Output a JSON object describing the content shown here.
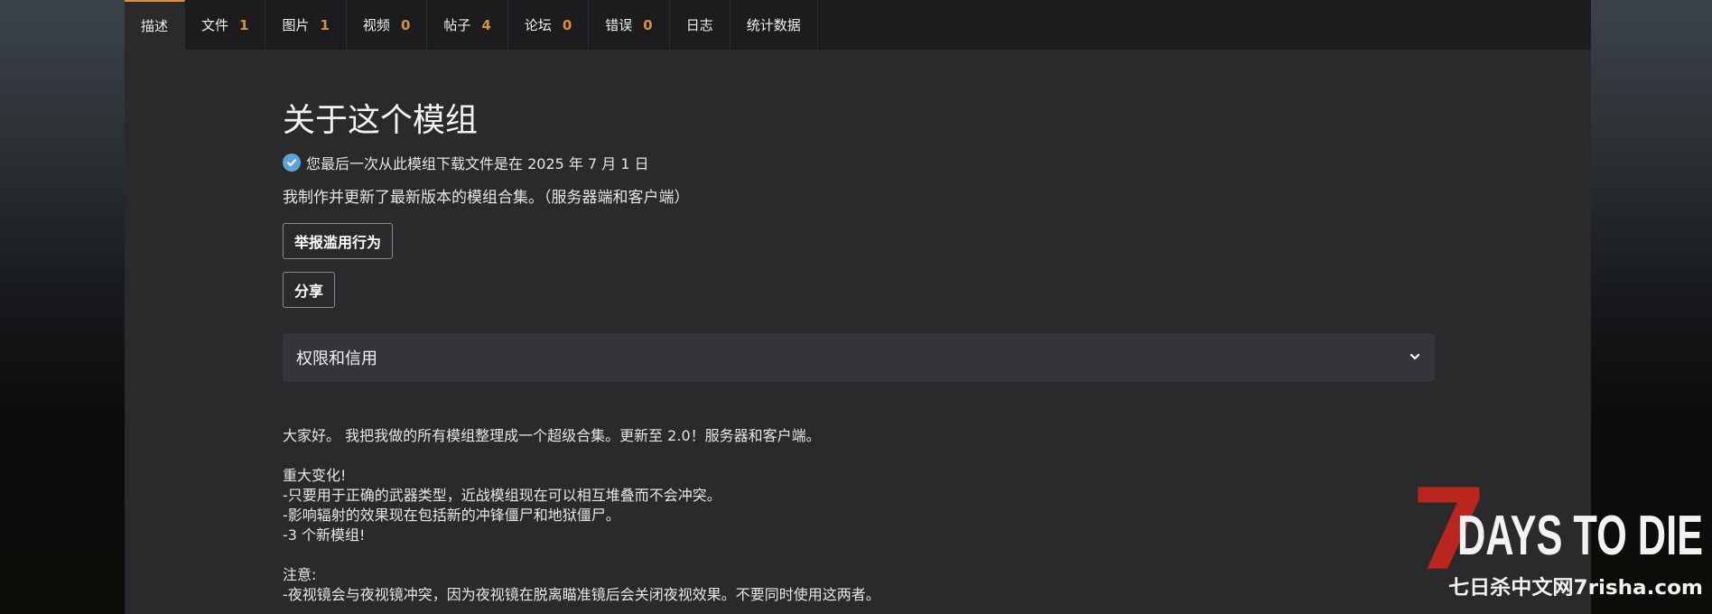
{
  "tabs": [
    {
      "label": "描述",
      "count": "",
      "active": true
    },
    {
      "label": "文件",
      "count": "1",
      "active": false
    },
    {
      "label": "图片",
      "count": "1",
      "active": false
    },
    {
      "label": "视频",
      "count": "0",
      "active": false
    },
    {
      "label": "帖子",
      "count": "4",
      "active": false
    },
    {
      "label": "论坛",
      "count": "0",
      "active": false
    },
    {
      "label": "错误",
      "count": "0",
      "active": false
    },
    {
      "label": "日志",
      "count": "",
      "active": false
    },
    {
      "label": "统计数据",
      "count": "",
      "active": false
    }
  ],
  "about": {
    "title": "关于这个模组",
    "download_note": "您最后一次从此模组下载文件是在 2025 年 7 月 1 日",
    "summary": "我制作并更新了最新版本的模组合集。（服务器端和客户端）",
    "report_button": "举报滥用行为",
    "share_button": "分享",
    "permissions_label": "权限和信用"
  },
  "description": {
    "intro": "大家好。 我把我做的所有模组整理成一个超级合集。更新至 2.0！服务器和客户端。",
    "changes_heading": "重大变化!",
    "changes": [
      "-只要用于正确的武器类型，近战模组现在可以相互堆叠而不会冲突。",
      "-影响辐射的效果现在包括新的冲锋僵尸和地狱僵尸。",
      "-3 个新模组!"
    ],
    "notes_heading": "注意:",
    "notes": [
      "-夜视镜会与夜视镜冲突，因为夜视镜在脱离瞄准镜后会关闭夜视效果。不要同时使用这两者。"
    ]
  },
  "watermark": {
    "logo_text": "DAYS TO DIE",
    "logo_number": "7",
    "site_text": "七日杀中文网7risha.com"
  },
  "colors": {
    "accent": "#d98f40",
    "check": "#5ea2d6",
    "logo_red": "#b8261d"
  },
  "icons": {
    "verified": "check-circle-icon",
    "accordion": "chevron-down-icon"
  }
}
